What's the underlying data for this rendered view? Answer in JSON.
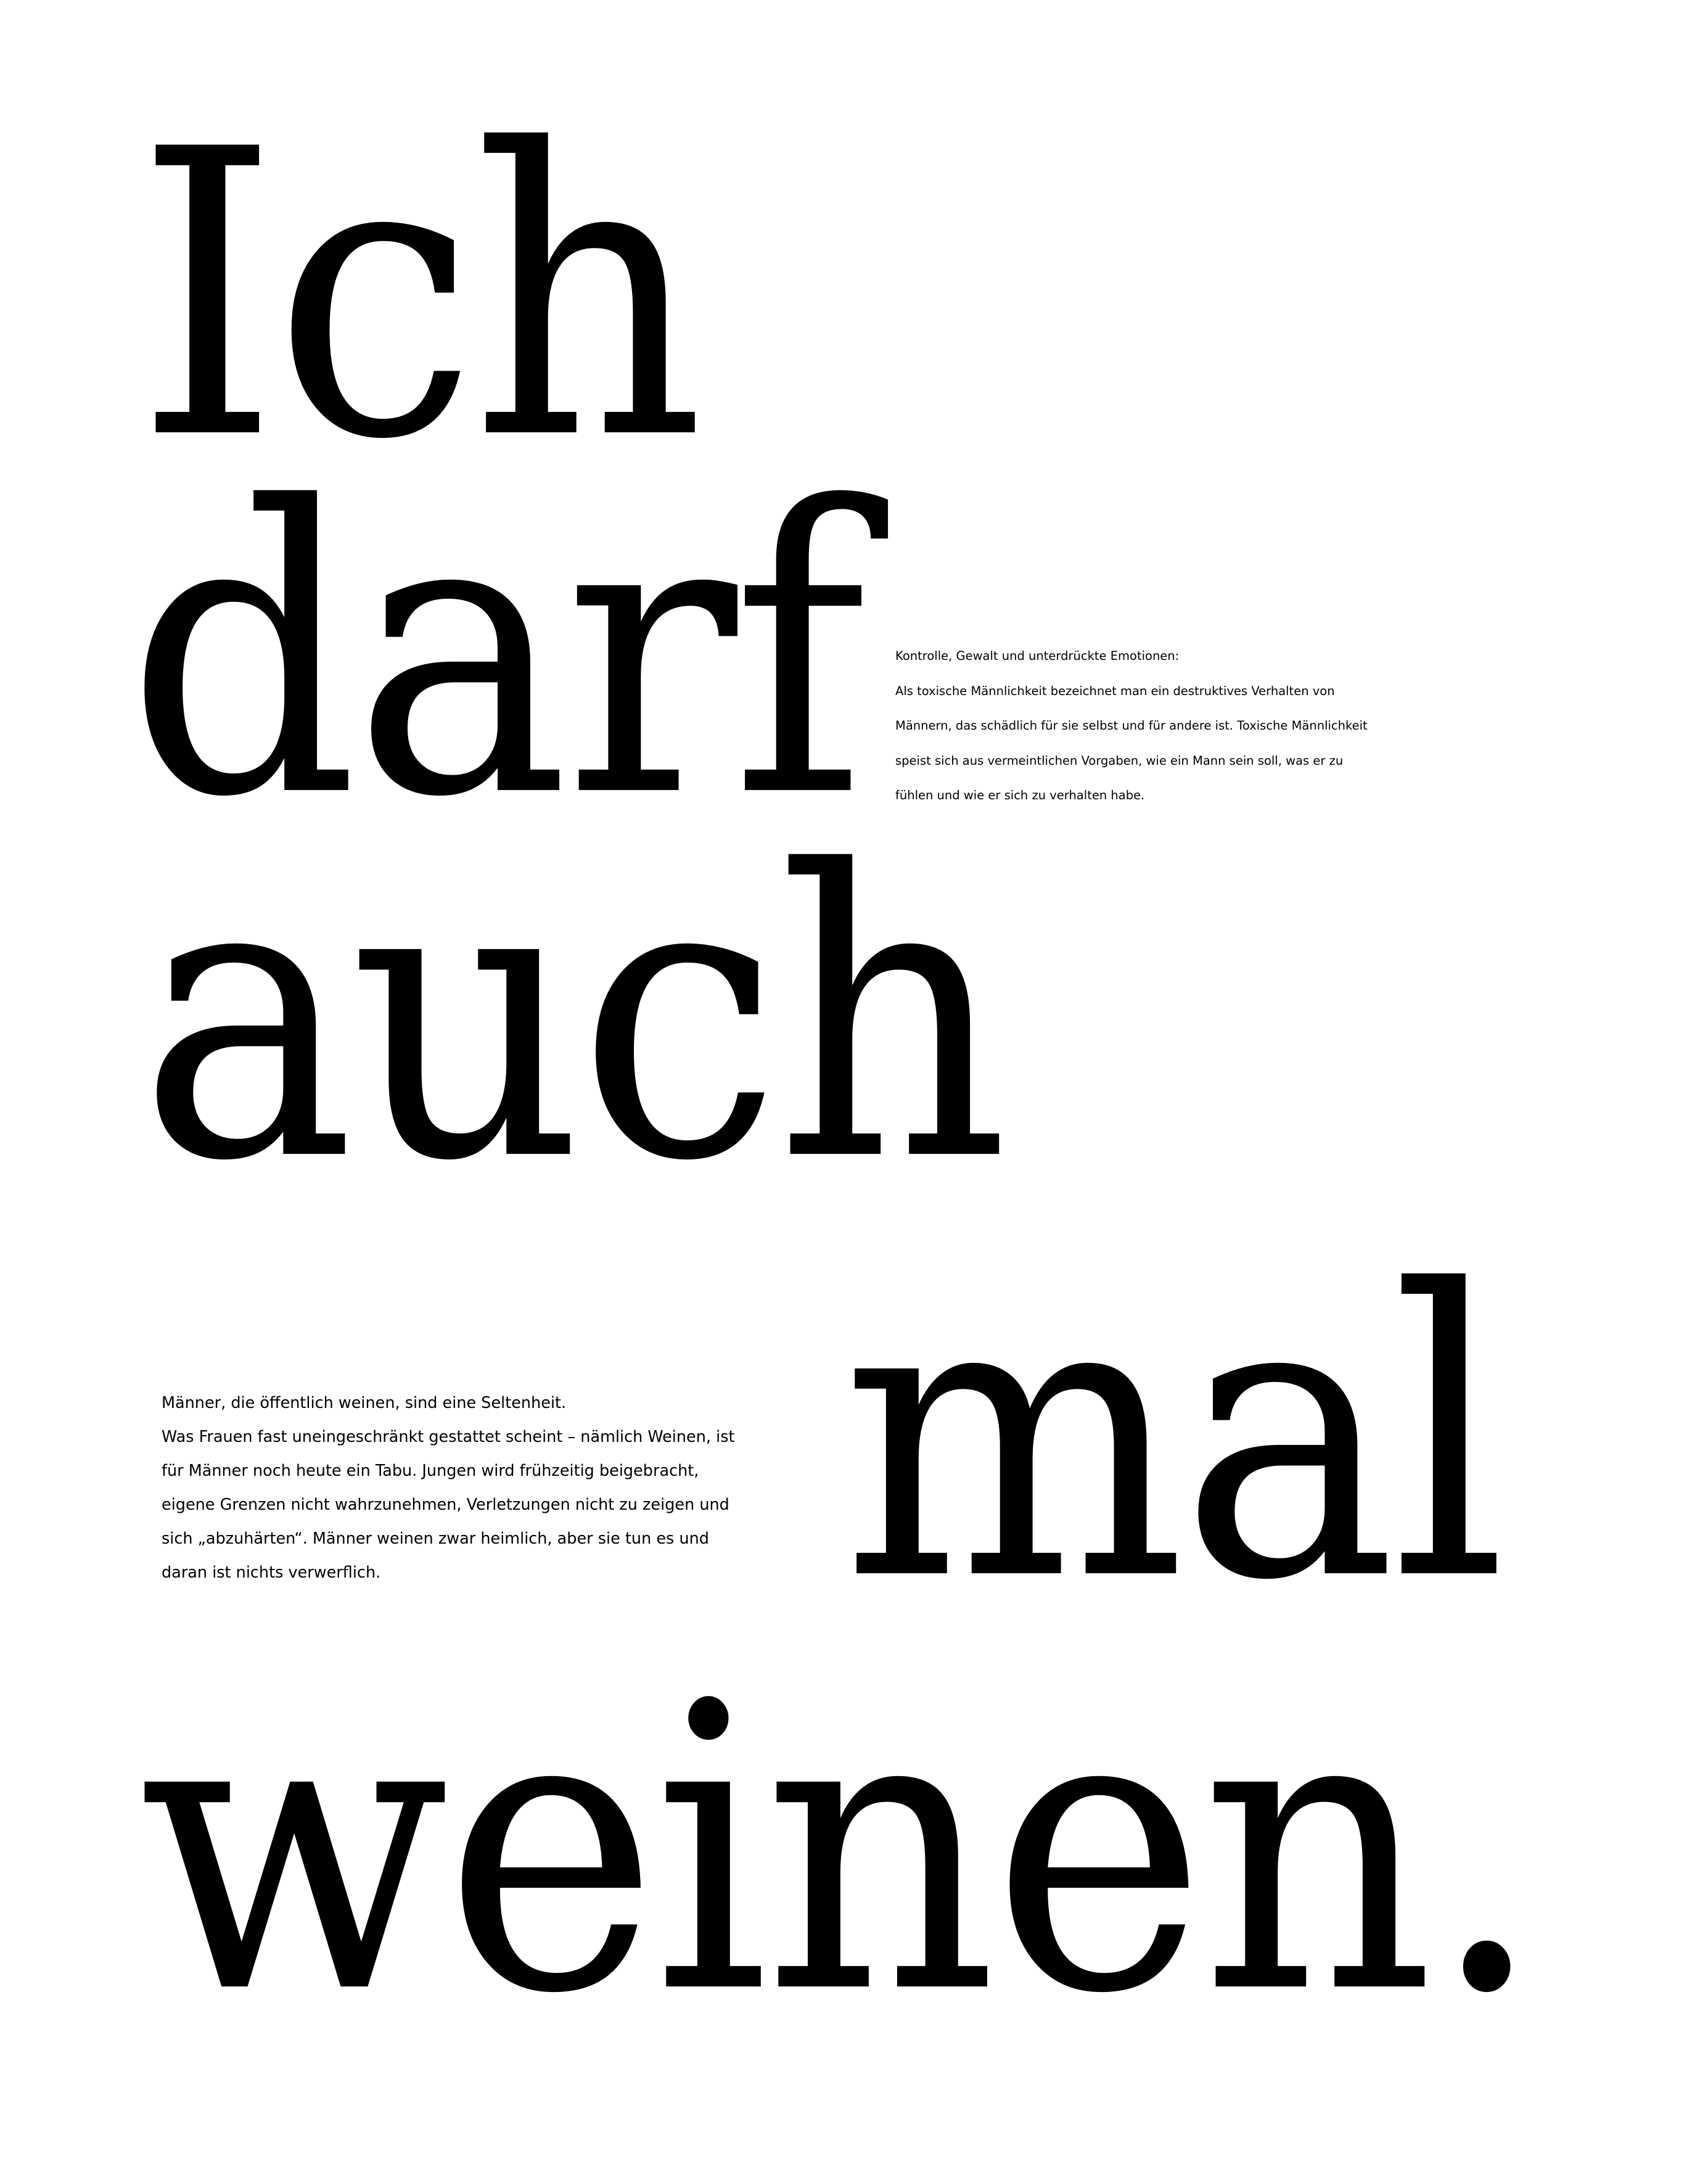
{
  "headline": {
    "word_1": "Ich",
    "word_2": "darf",
    "word_3": "auch",
    "word_4": "mal",
    "word_5": "weinen."
  },
  "side_note": {
    "lines": [
      "Kontrolle, Gewalt und unterdrückte Emotionen:",
      "Als toxische Männlichkeit bezeichnet man ein destruktives Verhalten von",
      "Männern, das schädlich für sie selbst und für andere ist. Toxische Männlichkeit",
      "speist sich aus vermeintlichen Vorgaben, wie ein Mann sein soll, was er zu",
      "fühlen und wie er sich zu verhalten habe."
    ]
  },
  "lead_note": {
    "lines": [
      "Männer, die öffentlich weinen, sind eine Seltenheit.",
      "Was Frauen fast uneingeschränkt gestattet scheint – nämlich Weinen, ist",
      "für Männer noch heute ein Tabu. Jungen wird frühzeitig beigebracht,",
      "eigene Grenzen nicht wahrzunehmen, Verletzungen nicht zu zeigen und",
      "sich „abzuhärten“.  Männer weinen zwar heimlich, aber sie tun es und",
      "daran ist nichts verwerflich."
    ]
  },
  "colors": {
    "background": "#ffffff",
    "text": "#000000"
  }
}
